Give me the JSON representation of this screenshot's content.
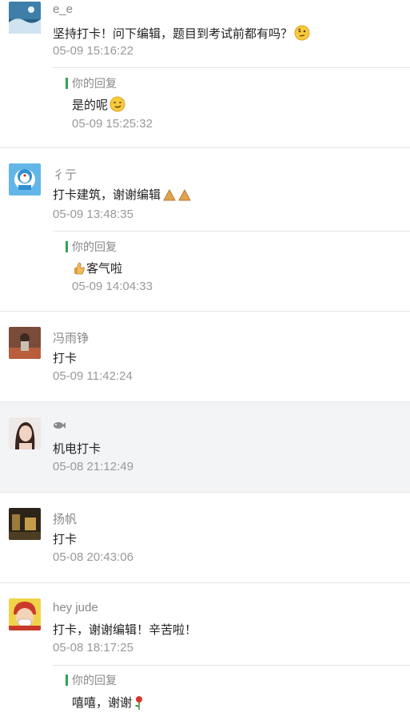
{
  "labels": {
    "reply": "你的回复"
  },
  "comments": [
    {
      "name": "e_e",
      "text": "坚持打卡！问下编辑，题目到考试前都有吗？",
      "time": "05-09 15:16:22",
      "reply": {
        "text": "是的呢",
        "time": "05-09 15:25:32"
      }
    },
    {
      "name": "彳亍",
      "text": "打卡建筑，谢谢编辑",
      "time": "05-09 13:48:35",
      "reply": {
        "text": "客气啦",
        "time": "05-09 14:04:33"
      }
    },
    {
      "name": "冯雨铮",
      "text": "打卡",
      "time": "05-09 11:42:24"
    },
    {
      "name": "",
      "text": "机电打卡",
      "time": "05-08 21:12:49"
    },
    {
      "name": "扬帆",
      "text": "打卡",
      "time": "05-08 20:43:06"
    },
    {
      "name": "hey jude",
      "text": "打卡，谢谢编辑！辛苦啦！",
      "time": "05-08 18:17:25",
      "reply": {
        "text": "嘻嘻，谢谢",
        "time": ""
      }
    }
  ],
  "icons": {
    "c1_emoji": "thinking-emoji-icon",
    "r1_emoji": "smirk-emoji-icon",
    "c2_emoji": "pray-hands-icon",
    "r2_emoji": "thumbs-up-icon",
    "c4_name": "fish-icon",
    "r6_emoji": "rose-icon"
  }
}
